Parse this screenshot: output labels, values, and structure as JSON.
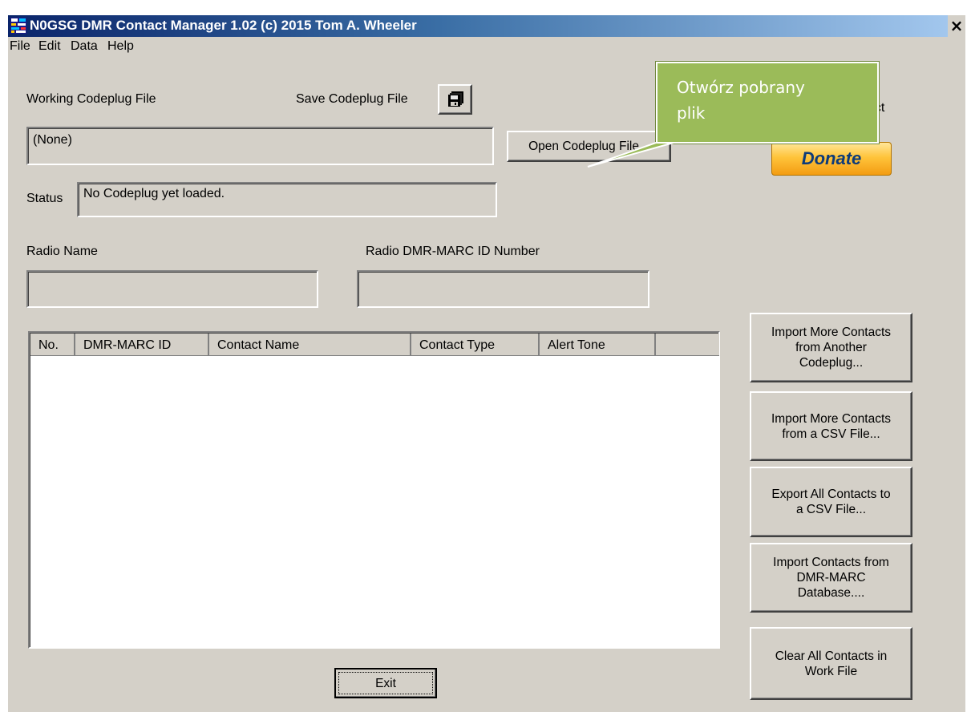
{
  "window": {
    "title": "N0GSG DMR Contact Manager 1.02 (c) 2015 Tom A. Wheeler",
    "close_glyph": "×"
  },
  "menu": [
    "File",
    "Edit",
    "Data",
    "Help"
  ],
  "codeplug": {
    "working_label": "Working Codeplug File",
    "save_label": "Save Codeplug File",
    "save_icon": "floppy-disk-icon",
    "file_value": "(None)",
    "open_button": "Open Codeplug File..."
  },
  "support": {
    "label_fragment": "ect",
    "donate_label": "Donate"
  },
  "callout": {
    "line1": "Otwórz pobrany",
    "line2": "plik",
    "bg_color": "#9bbb59"
  },
  "status": {
    "label": "Status",
    "value": "No Codeplug yet loaded."
  },
  "radio": {
    "name_label": "Radio Name",
    "name_value": "",
    "id_label": "Radio DMR-MARC ID Number",
    "id_value": ""
  },
  "contacts": {
    "columns": [
      "No.",
      "DMR-MARC ID",
      "Contact Name",
      "Contact Type",
      "Alert Tone",
      ""
    ],
    "rows": []
  },
  "actions": {
    "import_codeplug": [
      "Import More Contacts",
      "from Another",
      "Codeplug..."
    ],
    "import_csv": [
      "Import More Contacts",
      "from a CSV File..."
    ],
    "export_csv": [
      "Export All Contacts to",
      "a CSV File..."
    ],
    "import_dmrmarc": [
      "Import Contacts from",
      "DMR-MARC",
      "Database...."
    ],
    "clear_all": [
      "Clear All Contacts in",
      "Work File"
    ]
  },
  "exit_label": "Exit"
}
